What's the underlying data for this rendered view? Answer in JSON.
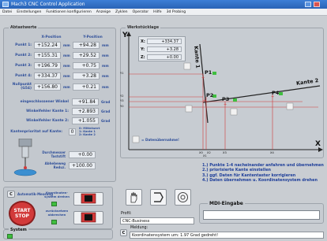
{
  "window": {
    "title": "Mach3 CNC Control Application"
  },
  "menu": [
    "Datei",
    "Einstellungen",
    "Funktionen konfigurieren",
    "Anzeige",
    "Zyklen",
    "Operator",
    "Hilfe",
    "3d Probing"
  ],
  "abtastwerte": {
    "title": "Abtastwerte",
    "col_x": "X-Position",
    "col_y": "Y-Position",
    "unit": "mm",
    "points": [
      {
        "label": "Punkt 1:",
        "x": "+152.24",
        "y": "+94.28"
      },
      {
        "label": "Punkt 2:",
        "x": "+155.31",
        "y": "+29.52"
      },
      {
        "label": "Punkt 3:",
        "x": "+196.79",
        "y": "+0.75"
      },
      {
        "label": "Punkt 4:",
        "x": "+334.37",
        "y": "+3.28"
      },
      {
        "label": "Nullpunkt (G54)",
        "x": "+156.80",
        "y": "+0.21"
      }
    ],
    "winkel_label": "eingeschlossener Winkel",
    "winkel_value": "+91.84",
    "winkel_unit": "Grad",
    "wfk1_label": "Winkelfehler Kante 1:",
    "wfk1_value": "+2.893",
    "wfk2_label": "Winkelfehler Kante 2:",
    "wfk2_value": "+1.055",
    "kp_label": "Kantenprioritat auf Kante:",
    "kp_value": "0",
    "kp_options": [
      "0: Mittelwert",
      "1: Kante 1",
      "2: Kante 2"
    ],
    "dm_label": "Durchmesser Taststift",
    "dm_value": "+0.00",
    "ab_label": "Abhebeweg Reduz.",
    "ab_value": "+100.00"
  },
  "werkstuck": {
    "title": "Werkstücklage",
    "readout": [
      {
        "axis": "X:",
        "value": "+334.37"
      },
      {
        "axis": "Y:",
        "value": "+3.28"
      },
      {
        "axis": "Z:",
        "value": "+0.00"
      }
    ],
    "axis_x": "X",
    "axis_y": "Y",
    "kante1": "Kante 1",
    "kante2": "Kante 2",
    "points": [
      "P1",
      "P2",
      "P3",
      "P4"
    ],
    "y_ticks": [
      "Y1",
      "Y2",
      "Y3",
      "Y0"
    ],
    "x_ticks": [
      "X0",
      "X1",
      "X2",
      "X3",
      "X4"
    ],
    "datenuebernahme": "= Datenübernahme!"
  },
  "instructions": [
    "1.) Punkte 1-4 nacheinander anfahren und übernehmen",
    "2.) priorisierte Kante einstellen",
    "3.) ggf. Daten für Kantentaster korrigieren",
    "4.) Daten übernehmen u. Koordinatensystem drehen"
  ],
  "controls": {
    "automatik_btn": "C",
    "automatik_label": "Automatik-Messung",
    "start_label": "START",
    "stop_label": "STOP",
    "koord_label": "Koordinaten-system drehen",
    "zurueck_label": "zurücksetzen abbrechen"
  },
  "profil": {
    "label": "Profil:",
    "value": "CNC-Business"
  },
  "mdi": {
    "label": "MDI-Eingabe",
    "value": ""
  },
  "meldung": {
    "btn": "C",
    "label": "Meldung:",
    "value": "Koordinatensystem um: 1.97 Grad gedreht!"
  },
  "system": {
    "label": "System"
  }
}
